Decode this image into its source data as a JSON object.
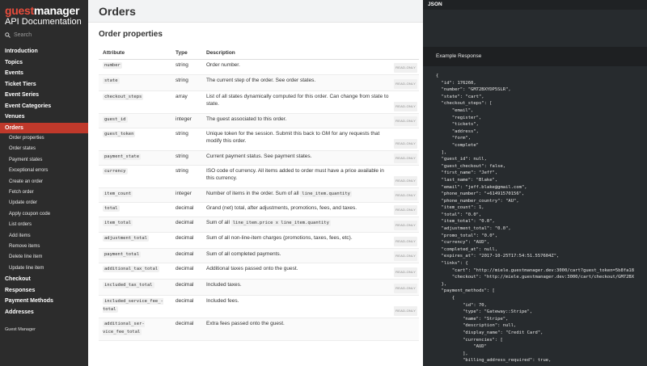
{
  "sidebar": {
    "logo_part1": "guest",
    "logo_part2": "manager",
    "subtitle": "API Documentation",
    "search_placeholder": "Search",
    "items": [
      {
        "label": "Introduction",
        "kind": "top"
      },
      {
        "label": "Topics",
        "kind": "top"
      },
      {
        "label": "Events",
        "kind": "top"
      },
      {
        "label": "Ticket Tiers",
        "kind": "top"
      },
      {
        "label": "Event Series",
        "kind": "top"
      },
      {
        "label": "Event Categories",
        "kind": "top"
      },
      {
        "label": "Venues",
        "kind": "top"
      },
      {
        "label": "Orders",
        "kind": "top",
        "active": true
      },
      {
        "label": "Order properties",
        "kind": "sub"
      },
      {
        "label": "Order states",
        "kind": "sub"
      },
      {
        "label": "Payment states",
        "kind": "sub"
      },
      {
        "label": "Exceptional errors",
        "kind": "sub"
      },
      {
        "label": "Create an order",
        "kind": "sub"
      },
      {
        "label": "Fetch order",
        "kind": "sub"
      },
      {
        "label": "Update order",
        "kind": "sub"
      },
      {
        "label": "Apply coupon code",
        "kind": "sub"
      },
      {
        "label": "List orders",
        "kind": "sub"
      },
      {
        "label": "Add items",
        "kind": "sub"
      },
      {
        "label": "Remove items",
        "kind": "sub"
      },
      {
        "label": "Delete line item",
        "kind": "sub"
      },
      {
        "label": "Update line item",
        "kind": "sub"
      },
      {
        "label": "Checkout",
        "kind": "top"
      },
      {
        "label": "Responses",
        "kind": "top"
      },
      {
        "label": "Payment Methods",
        "kind": "top"
      },
      {
        "label": "Addresses",
        "kind": "top"
      }
    ],
    "footer": "Guest Manager"
  },
  "main": {
    "title": "Orders",
    "section_title": "Order properties",
    "columns": [
      "Attribute",
      "Type",
      "Description"
    ],
    "read_only_label": "READ-ONLY",
    "rows": [
      {
        "attr": "number",
        "type": "string",
        "desc": "Order number.",
        "ro": true,
        "h": 19
      },
      {
        "attr": "state",
        "type": "string",
        "desc": "The current step of the order. See order states.",
        "ro": true,
        "h": 20
      },
      {
        "attr": "checkout_steps",
        "type": "array",
        "desc": "List of all states dynamically computed for this order. Can change from state to state.",
        "ro": true,
        "h": 28
      },
      {
        "attr": "guest_id",
        "type": "integer",
        "desc": "The guest associated to this order.",
        "ro": true,
        "h": 18
      },
      {
        "attr": "guest_token",
        "type": "string",
        "desc": "Unique token for the session. Submit this back to GM for any requests that modify this order.",
        "ro": true,
        "h": 28
      },
      {
        "attr": "payment_state",
        "type": "string",
        "desc": "Current payment status. See payment states.",
        "ro": true,
        "h": 18
      },
      {
        "attr": "currency",
        "type": "string",
        "desc": "ISO code of currency. All items added to order must have a price available in this currency.",
        "ro": true,
        "h": 28
      },
      {
        "attr": "item_count",
        "type": "integer",
        "desc": "Number of items in the order. Sum of all",
        "code": "line_item.quantity",
        "ro": true,
        "h": 18
      },
      {
        "attr": "total",
        "type": "decimal",
        "desc": "Grand (net) total, after adjustments, promotions, fees, and taxes.",
        "ro": true,
        "h": 18
      },
      {
        "attr": "item_total",
        "type": "decimal",
        "desc": "Sum of all",
        "code": "line_item.price x line_item.quantity",
        "ro": true,
        "h": 19
      },
      {
        "attr": "adjustment_total",
        "type": "decimal",
        "desc": "Sum of all non-line-item charges (promotions, taxes, fees, etc).",
        "ro": true,
        "h": 20
      },
      {
        "attr": "payment_total",
        "type": "decimal",
        "desc": "Sum of all completed payments.",
        "ro": true,
        "h": 18
      },
      {
        "attr": "additional_tax_total",
        "type": "decimal",
        "desc": "Additional taxes passed onto the guest.",
        "ro": true,
        "h": 20
      },
      {
        "attr": "included_tax_total",
        "type": "decimal",
        "desc": "Included taxes.",
        "ro": true,
        "h": 20
      },
      {
        "attr": "included_service_fee_-total",
        "type": "decimal",
        "desc": "Included fees.",
        "ro": true,
        "h": 28
      },
      {
        "attr": "additional_ser-vice_fee_total",
        "type": "decimal",
        "desc": "Extra fees passed onto the guest.",
        "ro": false,
        "h": 28
      }
    ]
  },
  "panel": {
    "tab": "JSON",
    "example_label": "Example Response",
    "code": [
      "{",
      "  \"id\": 176260,",
      "  \"number\": \"GM72BXYDP5SLR\",",
      "  \"state\": \"cart\",",
      "  \"checkout_steps\": [",
      "      \"email\",",
      "      \"register\",",
      "      \"tickets\",",
      "      \"address\",",
      "      \"form\",",
      "      \"complete\"",
      "  ],",
      "  \"guest_id\": null,",
      "  \"guest_checkout\": false,",
      "  \"first_name\": \"Jeff\",",
      "  \"last_name\": \"Blake\",",
      "  \"email\": \"jeff.blake@gmail.com\",",
      "  \"phone_number\": \"+61491570156\",",
      "  \"phone_number_country\": \"AU\",",
      "  \"item_count\": 1,",
      "  \"total\": \"0.0\",",
      "  \"item_total\": \"0.0\",",
      "  \"adjustment_total\": \"0.0\",",
      "  \"promo_total\": \"0.0\",",
      "  \"currency\": \"AUD\",",
      "  \"completed_at\": null,",
      "  \"expires_at\": \"2017-10-25T17:54:51.557604Z\",",
      "  \"links\": {",
      "      \"cart\": \"http://miele.guestmanager.dev:3000/cart?guest_token=5b8fa18",
      "      \"checkout\": \"http://miele.guestmanager.dev:3000/cart/checkout/GM72BX",
      "  },",
      "  \"payment_methods\": [",
      "      {",
      "          \"id\": 70,",
      "          \"type\": \"Gateway::Stripe\",",
      "          \"name\": \"Stripe\",",
      "          \"description\": null,",
      "          \"display_name\": \"Credit Card\",",
      "          \"currencies\": [",
      "              \"AUD\"",
      "          ],",
      "          \"billing_address_required\": true,"
    ]
  }
}
